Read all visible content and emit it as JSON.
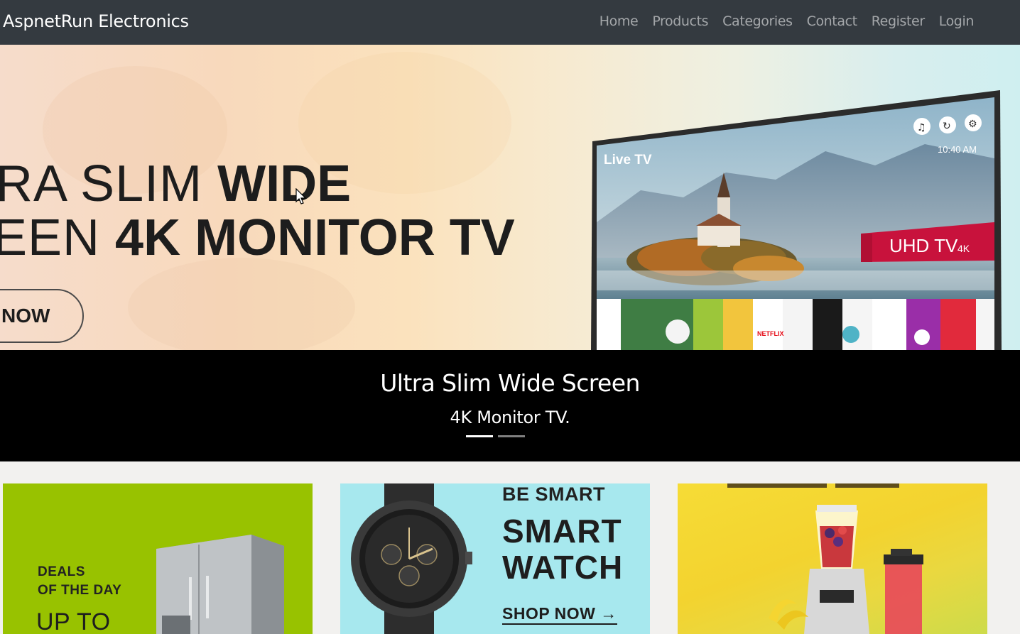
{
  "navbar": {
    "brand": "AspnetRun Electronics",
    "links": [
      "Home",
      "Products",
      "Categories",
      "Contact",
      "Register",
      "Login"
    ],
    "background": "#343a40"
  },
  "hero": {
    "line1_light": "RA SLIM ",
    "line1_bold": "WIDE",
    "line2_light": "EEN ",
    "line2_bold": "4K MONITOR TV",
    "button": "NOW",
    "tv": {
      "live_label": "Live TV",
      "time": "10:40 AM",
      "badge": "UHD TV",
      "badge_suffix": "4K"
    }
  },
  "caption": {
    "title": "Ultra Slim Wide Screen",
    "subtitle": "4K Monitor TV.",
    "slides": 2,
    "active_slide": 1
  },
  "cards": {
    "fridge": {
      "line1": "DEALS",
      "line2": "OF THE DAY",
      "upto": "UP TO",
      "color": "#98c200"
    },
    "watch": {
      "tagline": "BE SMART",
      "line1": "SMART",
      "line2": "WATCH",
      "cta": "SHOP NOW →",
      "color": "#a7e8ee"
    },
    "blender": {
      "color": "#f4d632"
    }
  }
}
